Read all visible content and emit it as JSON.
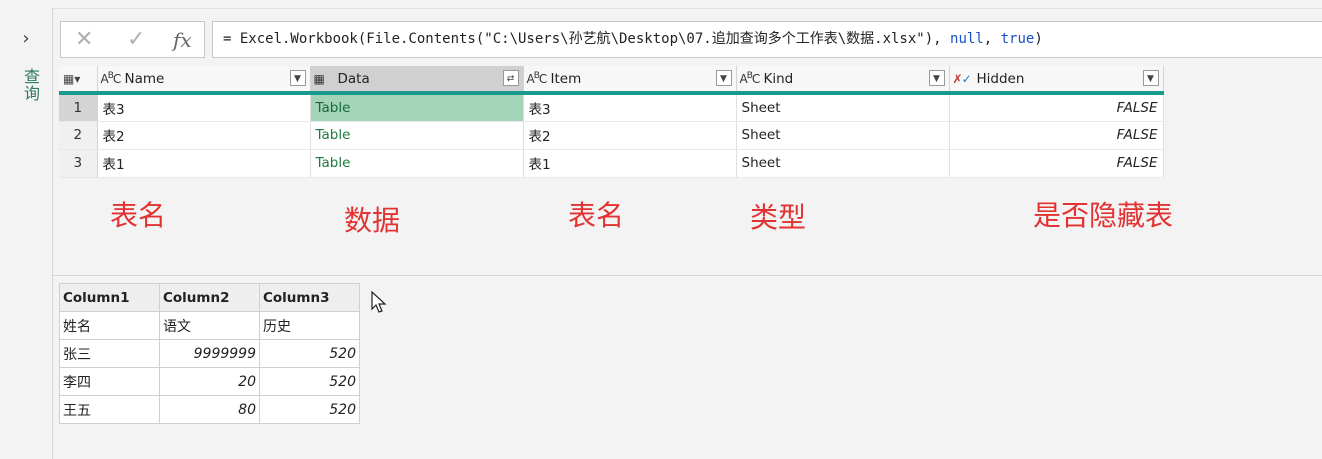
{
  "queries_pane": {
    "expand_glyph": "›",
    "label": "查询"
  },
  "formula_bar": {
    "cancel_glyph": "✕",
    "commit_glyph": "✓",
    "fx_label": "fx",
    "formula_prefix": "= Excel.Workbook(File.Contents(\"C:\\Users\\孙艺航\\Desktop\\07.追加查询多个工作表\\数据.xlsx\"), ",
    "formula_null": "null",
    "formula_sep": ", ",
    "formula_true": "true",
    "formula_suffix": ")"
  },
  "grid": {
    "corner_icon": "table-menu-icon",
    "columns": [
      {
        "name": "Name",
        "type_icon": "text-type-icon"
      },
      {
        "name": "Data",
        "type_icon": "table-type-icon"
      },
      {
        "name": "Item",
        "type_icon": "text-type-icon"
      },
      {
        "name": "Kind",
        "type_icon": "text-type-icon"
      },
      {
        "name": "Hidden",
        "type_icon": "any-type-icon"
      }
    ],
    "rows": [
      {
        "num": "1",
        "name": "表3",
        "data": "Table",
        "item": "表3",
        "kind": "Sheet",
        "hidden": "FALSE"
      },
      {
        "num": "2",
        "name": "表2",
        "data": "Table",
        "item": "表2",
        "kind": "Sheet",
        "hidden": "FALSE"
      },
      {
        "num": "3",
        "name": "表1",
        "data": "Table",
        "item": "表1",
        "kind": "Sheet",
        "hidden": "FALSE"
      }
    ]
  },
  "annotations": {
    "name": "表名",
    "data": "数据",
    "item": "表名",
    "kind": "类型",
    "hidden": "是否隐藏表"
  },
  "accent_color": "#1a9a8c",
  "annotation_color": "#e23232",
  "preview": {
    "headers": [
      "Column1",
      "Column2",
      "Column3"
    ],
    "rows": [
      [
        "姓名",
        "语文",
        "历史"
      ],
      [
        "张三",
        "9999999",
        "520"
      ],
      [
        "李四",
        "20",
        "520"
      ],
      [
        "王五",
        "80",
        "520"
      ]
    ]
  }
}
